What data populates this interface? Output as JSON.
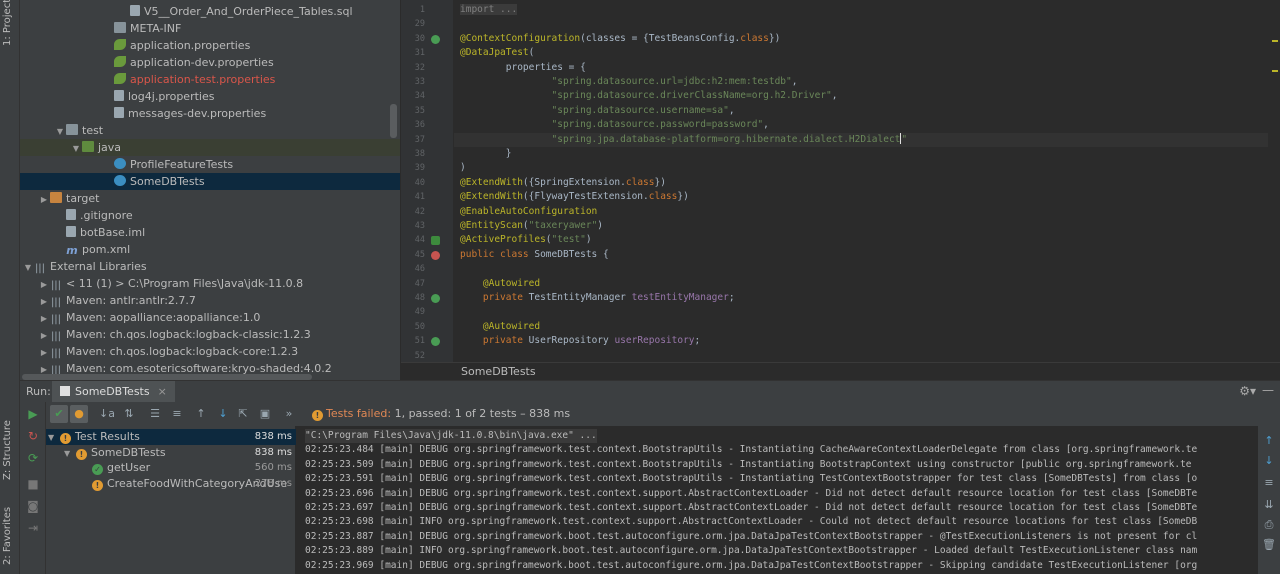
{
  "side_tabs": {
    "project": "1: Project",
    "structure": "Z: Structure",
    "favorites": "2: Favorites"
  },
  "project_tree": [
    {
      "label": "V5__Order_And_OrderPiece_Tables.sql",
      "indent": 6,
      "icon": "sql-file-icon",
      "arrow": ""
    },
    {
      "label": "META-INF",
      "indent": 5,
      "icon": "folder-icon",
      "arrow": ""
    },
    {
      "label": "application.properties",
      "indent": 5,
      "icon": "spring-leaf-icon",
      "arrow": ""
    },
    {
      "label": "application-dev.properties",
      "indent": 5,
      "icon": "spring-leaf-icon",
      "arrow": ""
    },
    {
      "label": "application-test.properties",
      "indent": 5,
      "icon": "spring-leaf-icon",
      "arrow": "",
      "color": "red"
    },
    {
      "label": "log4j.properties",
      "indent": 5,
      "icon": "properties-file-icon",
      "arrow": ""
    },
    {
      "label": "messages-dev.properties",
      "indent": 5,
      "icon": "properties-file-icon",
      "arrow": ""
    },
    {
      "label": "test",
      "indent": 2,
      "icon": "folder-icon",
      "arrow": "▼"
    },
    {
      "label": "java",
      "indent": 3,
      "icon": "test-folder-icon",
      "arrow": "▼"
    },
    {
      "label": "ProfileFeatureTests",
      "indent": 5,
      "icon": "class-icon",
      "arrow": ""
    },
    {
      "label": "SomeDBTests",
      "indent": 5,
      "icon": "class-icon",
      "arrow": "",
      "selected": true
    },
    {
      "label": "target",
      "indent": 1,
      "icon": "excluded-folder-icon",
      "arrow": "▶"
    },
    {
      "label": ".gitignore",
      "indent": 2,
      "icon": "file-icon",
      "arrow": ""
    },
    {
      "label": "botBase.iml",
      "indent": 2,
      "icon": "file-icon",
      "arrow": ""
    },
    {
      "label": "pom.xml",
      "indent": 2,
      "icon": "maven-icon",
      "arrow": ""
    },
    {
      "label": "External Libraries",
      "indent": 0,
      "icon": "library-icon",
      "arrow": "▼"
    },
    {
      "label": "< 11 (1) >  C:\\Program Files\\Java\\jdk-11.0.8",
      "indent": 1,
      "icon": "library-icon",
      "arrow": "▶"
    },
    {
      "label": "Maven: antlr:antlr:2.7.7",
      "indent": 1,
      "icon": "library-icon",
      "arrow": "▶"
    },
    {
      "label": "Maven: aopalliance:aopalliance:1.0",
      "indent": 1,
      "icon": "library-icon",
      "arrow": "▶"
    },
    {
      "label": "Maven: ch.qos.logback:logback-classic:1.2.3",
      "indent": 1,
      "icon": "library-icon",
      "arrow": "▶"
    },
    {
      "label": "Maven: ch.qos.logback:logback-core:1.2.3",
      "indent": 1,
      "icon": "library-icon",
      "arrow": "▶"
    },
    {
      "label": "Maven: com.esotericsoftware:kryo-shaded:4.0.2",
      "indent": 1,
      "icon": "library-icon",
      "arrow": "▶"
    }
  ],
  "editor": {
    "lines": [
      {
        "n": "1",
        "html": "<span class=\"fold\">import ...</span>"
      },
      {
        "n": "29",
        "html": ""
      },
      {
        "n": "30",
        "html": "<span class=\"ann\">@ContextConfiguration</span>(classes = {TestBeansConfig.<span class=\"kw\">class</span>})"
      },
      {
        "n": "31",
        "html": "<span class=\"ann\">@DataJpaTest</span>("
      },
      {
        "n": "32",
        "html": "        properties = {"
      },
      {
        "n": "33",
        "html": "                <span class=\"str\">\"spring.datasource.url=jdbc:h2:mem:testdb\"</span>,"
      },
      {
        "n": "34",
        "html": "                <span class=\"str\">\"spring.datasource.driverClassName=org.h2.Driver\"</span>,"
      },
      {
        "n": "35",
        "html": "                <span class=\"str\">\"spring.datasource.username=sa\"</span>,"
      },
      {
        "n": "36",
        "html": "                <span class=\"str\">\"spring.datasource.password=password\"</span>,"
      },
      {
        "n": "37",
        "html": "                <span class=\"str\">\"spring.jpa.database-platform=org.hibernate.dialect.H2Dialect</span><span id=\"caret\"></span><span class=\"str\">\"</span>"
      },
      {
        "n": "38",
        "html": "        }"
      },
      {
        "n": "39",
        "html": ")"
      },
      {
        "n": "40",
        "html": "<span class=\"ann\">@ExtendWith</span>({SpringExtension.<span class=\"kw\">class</span>})"
      },
      {
        "n": "41",
        "html": "<span class=\"ann\">@ExtendWith</span>({FlywayTestExtension.<span class=\"kw\">class</span>})"
      },
      {
        "n": "42",
        "html": "<span class=\"ann\">@EnableAutoConfiguration</span>"
      },
      {
        "n": "43",
        "html": "<span class=\"ann\">@EntityScan</span>(<span class=\"str\">\"taxeryawer\"</span>)"
      },
      {
        "n": "44",
        "html": "<span class=\"ann\">@ActiveProfiles</span>(<span class=\"str\">\"test\"</span>)"
      },
      {
        "n": "45",
        "html": "<span class=\"kw\">public class</span> SomeDBTests {"
      },
      {
        "n": "46",
        "html": ""
      },
      {
        "n": "47",
        "html": "    <span class=\"ann\">@Autowired</span>"
      },
      {
        "n": "48",
        "html": "    <span class=\"kw\">private</span> TestEntityManager <span class=\"fld\">testEntityManager</span>;"
      },
      {
        "n": "49",
        "html": ""
      },
      {
        "n": "50",
        "html": "    <span class=\"ann\">@Autowired</span>"
      },
      {
        "n": "51",
        "html": "    <span class=\"kw\">private</span> UserRepository <span class=\"fld\">userRepository</span>;"
      },
      {
        "n": "52",
        "html": ""
      }
    ],
    "breadcrumb": "SomeDBTests"
  },
  "run": {
    "label": "Run:",
    "tab_label": "SomeDBTests",
    "status_prefix": "Tests failed: ",
    "failed_count": "1",
    "status_suffix": ", passed: 1 of 2 tests – 838 ms",
    "tree": [
      {
        "label": "Test Results",
        "time": "838 ms",
        "status": "warn",
        "indent": 0,
        "arrow": "▼",
        "selected": true
      },
      {
        "label": "SomeDBTests",
        "time": "838 ms",
        "status": "warn",
        "indent": 1,
        "arrow": "▼"
      },
      {
        "label": "getUser",
        "time": "560 ms",
        "status": "ok",
        "indent": 2,
        "arrow": ""
      },
      {
        "label": "CreateFoodWithCategoryAndUse",
        "time": "278 ms",
        "status": "warn",
        "indent": 2,
        "arrow": ""
      }
    ],
    "console": [
      "\"C:\\Program Files\\Java\\jdk-11.0.8\\bin\\java.exe\" ...",
      "02:25:23.484 [main] DEBUG org.springframework.test.context.BootstrapUtils - Instantiating CacheAwareContextLoaderDelegate from class [org.springframework.te",
      "02:25:23.509 [main] DEBUG org.springframework.test.context.BootstrapUtils - Instantiating BootstrapContext using constructor [public org.springframework.te",
      "02:25:23.591 [main] DEBUG org.springframework.test.context.BootstrapUtils - Instantiating TestContextBootstrapper for test class [SomeDBTests] from class [o",
      "02:25:23.696 [main] DEBUG org.springframework.test.context.support.AbstractContextLoader - Did not detect default resource location for test class [SomeDBTe",
      "02:25:23.697 [main] DEBUG org.springframework.test.context.support.AbstractContextLoader - Did not detect default resource location for test class [SomeDBTe",
      "02:25:23.698 [main] INFO org.springframework.test.context.support.AbstractContextLoader - Could not detect default resource locations for test class [SomeDB",
      "02:25:23.887 [main] DEBUG org.springframework.boot.test.autoconfigure.orm.jpa.DataJpaTestContextBootstrapper - @TestExecutionListeners is not present for cl",
      "02:25:23.889 [main] INFO org.springframework.boot.test.autoconfigure.orm.jpa.DataJpaTestContextBootstrapper - Loaded default TestExecutionListener class nam",
      "02:25:23.969 [main] DEBUG org.springframework.boot.test.autoconfigure.orm.jpa.DataJpaTestContextBootstrapper - Skipping candidate TestExecutionListener [org"
    ]
  }
}
